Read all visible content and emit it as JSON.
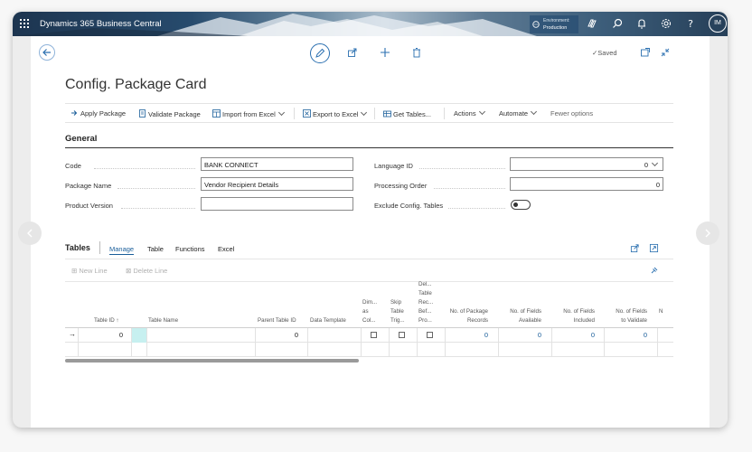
{
  "app": {
    "title": "Dynamics 365 Business Central",
    "avatar": "IM"
  },
  "environment": {
    "label": "Environment:",
    "value": "Production"
  },
  "header": {
    "saved_label": "Saved",
    "page_title": "Config. Package Card"
  },
  "actions": [
    {
      "label": "Apply Package",
      "icon": "apply-icon"
    },
    {
      "label": "Validate Package",
      "icon": "document-icon"
    },
    {
      "label": "Import from Excel",
      "icon": "import-icon"
    },
    {
      "label": "Export to Excel",
      "icon": "excel-icon"
    },
    {
      "label": "Get Tables...",
      "icon": "get-tables-icon"
    },
    {
      "label": "Actions"
    },
    {
      "label": "Automate"
    },
    {
      "label": "Fewer options"
    }
  ],
  "general": {
    "title": "General",
    "code": {
      "label": "Code",
      "value": "BANK CONNECT"
    },
    "package_name": {
      "label": "Package Name",
      "value": "Vendor Recipient Details"
    },
    "product_version": {
      "label": "Product Version",
      "value": ""
    },
    "language_id": {
      "label": "Language ID",
      "value": "0"
    },
    "processing_order": {
      "label": "Processing Order",
      "value": "0"
    },
    "exclude_config_tables": {
      "label": "Exclude Config. Tables",
      "value": "off"
    }
  },
  "tables": {
    "title": "Tables",
    "tabs": [
      "Manage",
      "Table",
      "Functions",
      "Excel"
    ],
    "new_line": "New Line",
    "delete_line": "Delete Line",
    "columns": {
      "table_id": "Table ID ↑",
      "table_name": "Table Name",
      "parent_table_id": "Parent Table ID",
      "data_template": "Data Template",
      "dim_as_col": [
        "Dim...",
        "as",
        "Col..."
      ],
      "skip_table_trig": [
        "Skip",
        "Table",
        "Trig..."
      ],
      "del_table_rec": [
        "Del...",
        "Table",
        "Rec...",
        "Bef...",
        "Pro..."
      ],
      "no_package_records": [
        "No. of Package",
        "Records"
      ],
      "no_fields_available": [
        "No. of Fields",
        "Available"
      ],
      "no_fields_included": [
        "No. of Fields",
        "Included"
      ],
      "no_fields_validate": [
        "No. of Fields",
        "to Validate"
      ],
      "n_truncated": "N"
    },
    "row": {
      "table_id": "0",
      "parent_table_id": "0",
      "no_package_records": "0",
      "no_fields_available": "0",
      "no_fields_included": "0",
      "no_fields_validate": "0"
    }
  }
}
